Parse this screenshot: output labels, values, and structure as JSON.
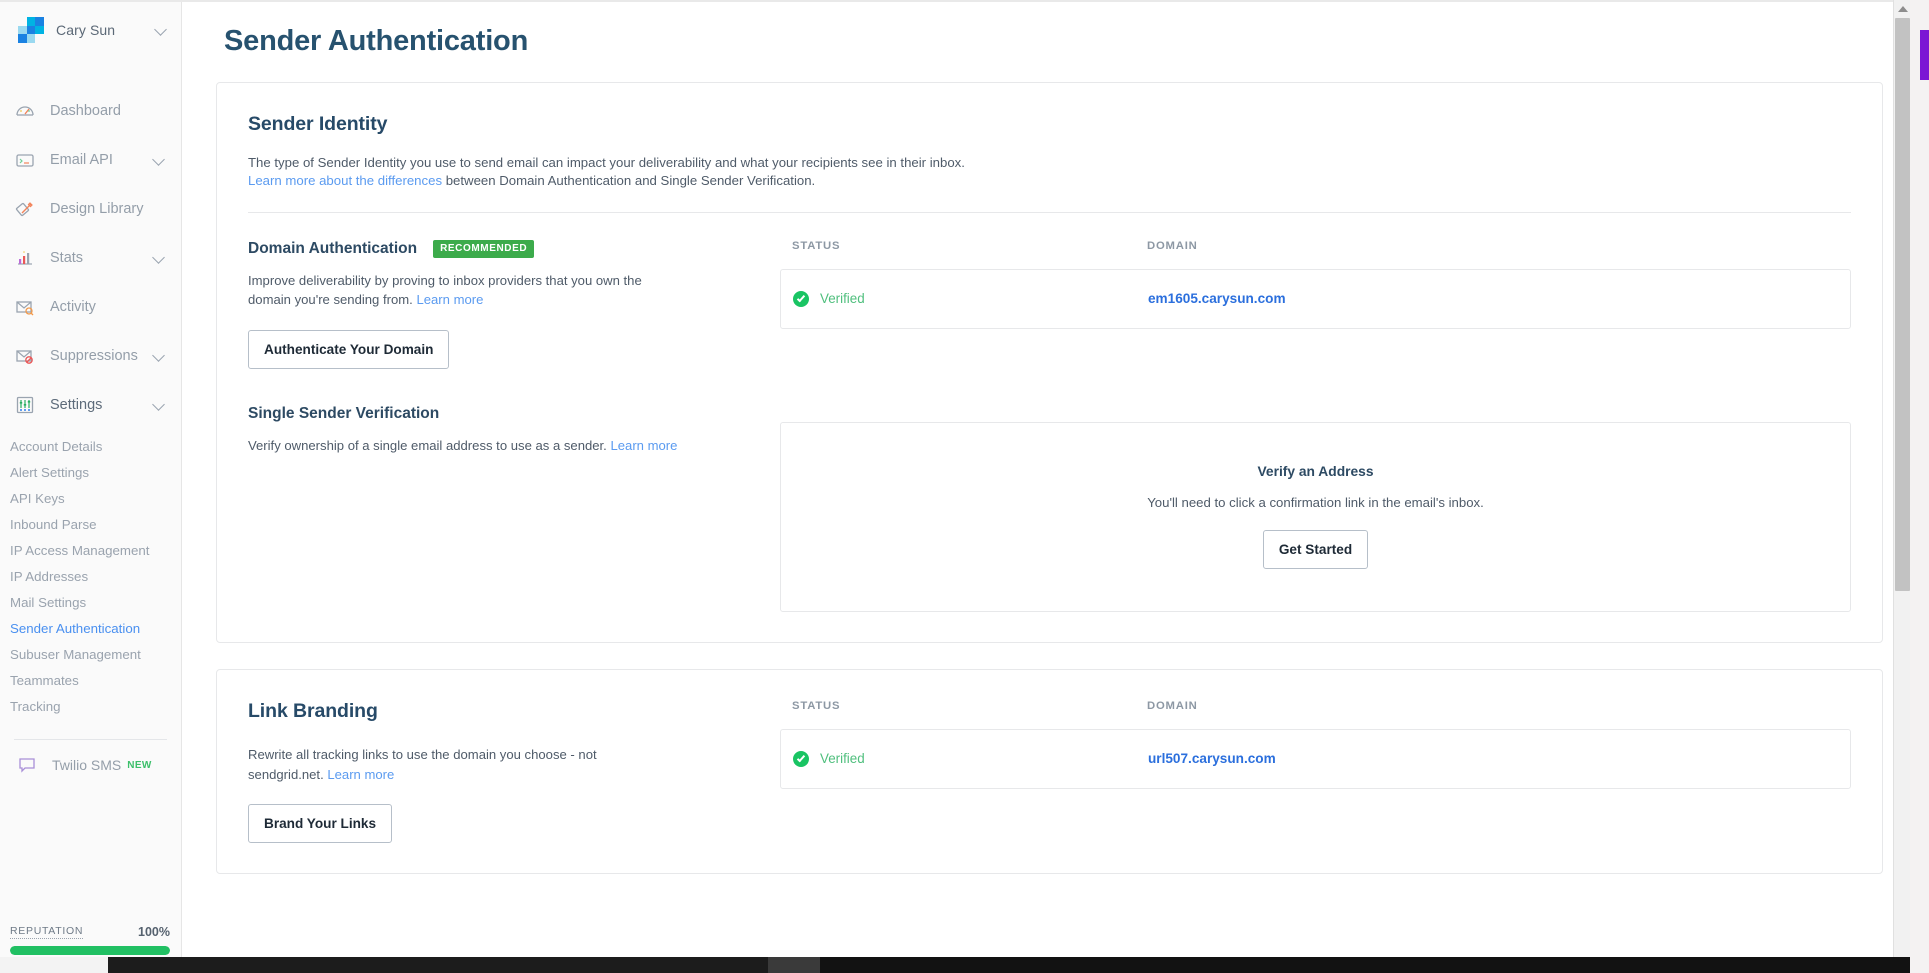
{
  "sidebar": {
    "brand": {
      "name": "Cary Sun",
      "logo_colors": [
        "#00b3e3",
        "#1a82e2",
        "#9ad9f0",
        "#00b3e3",
        "#1a82e2",
        "#9ad9f0"
      ]
    },
    "nav": [
      {
        "label": "Dashboard",
        "icon": "dashboard-gauge-icon",
        "caret": false
      },
      {
        "label": "Email API",
        "icon": "email-api-icon",
        "caret": true
      },
      {
        "label": "Design Library",
        "icon": "design-library-pencil-icon",
        "caret": false
      },
      {
        "label": "Stats",
        "icon": "stats-bar-icon",
        "caret": true
      },
      {
        "label": "Activity",
        "icon": "activity-envelope-search-icon",
        "caret": false
      },
      {
        "label": "Suppressions",
        "icon": "suppressions-envelope-block-icon",
        "caret": true
      },
      {
        "label": "Settings",
        "icon": "settings-sliders-icon",
        "caret": true
      }
    ],
    "settings_subnav": [
      {
        "label": "Account Details",
        "selected": false
      },
      {
        "label": "Alert Settings",
        "selected": false
      },
      {
        "label": "API Keys",
        "selected": false
      },
      {
        "label": "Inbound Parse",
        "selected": false
      },
      {
        "label": "IP Access Management",
        "selected": false
      },
      {
        "label": "IP Addresses",
        "selected": false
      },
      {
        "label": "Mail Settings",
        "selected": false
      },
      {
        "label": "Sender Authentication",
        "selected": true
      },
      {
        "label": "Subuser Management",
        "selected": false
      },
      {
        "label": "Teammates",
        "selected": false
      },
      {
        "label": "Tracking",
        "selected": false
      }
    ],
    "twilio": {
      "label": "Twilio SMS",
      "badge": "NEW",
      "icon": "sms-chat-bubble-icon"
    },
    "reputation": {
      "label": "REPUTATION",
      "value": "100%",
      "percent": 100,
      "bar_color": "#21c063"
    }
  },
  "page": {
    "title": "Sender Authentication"
  },
  "sender_identity": {
    "title": "Sender Identity",
    "description_line1": "The type of Sender Identity you use to send email can impact your deliverability and what your recipients see in their inbox.",
    "link_text": "Learn more about the differences",
    "description_line2": " between Domain Authentication and Single Sender Verification.",
    "domain_auth": {
      "title": "Domain Authentication",
      "badge": "RECOMMENDED",
      "badge_color": "#3cab4b",
      "description": "Improve deliverability by proving to inbox providers that you own the domain you're sending from. ",
      "link_text": "Learn more",
      "button": "Authenticate Your Domain",
      "table": {
        "headers": [
          "STATUS",
          "DOMAIN"
        ],
        "rows": [
          {
            "status": "Verified",
            "domain": "em1605.carysun.com"
          }
        ]
      }
    },
    "single_sender": {
      "title": "Single Sender Verification",
      "description": "Verify ownership of a single email address to use as a sender. ",
      "link_text": "Learn more",
      "empty_state": {
        "title": "Verify an Address",
        "subtitle": "You'll need to click a confirmation link in the email's inbox.",
        "button": "Get Started"
      }
    }
  },
  "link_branding": {
    "title": "Link Branding",
    "description": "Rewrite all tracking links to use the domain you choose - not sendgrid.net. ",
    "link_text": "Learn more",
    "button": "Brand Your Links",
    "table": {
      "headers": [
        "STATUS",
        "DOMAIN"
      ],
      "rows": [
        {
          "status": "Verified",
          "domain": "url507.carysun.com"
        }
      ]
    }
  }
}
